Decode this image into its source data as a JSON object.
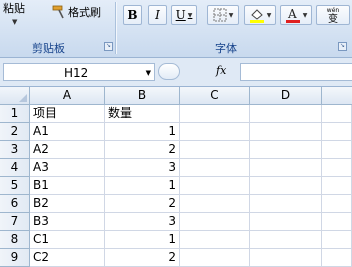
{
  "ribbon": {
    "paste_label": "粘贴",
    "format_painter_label": "格式刷",
    "clipboard_group_label": "剪贴板",
    "font_group_label": "字体",
    "bold_label": "B",
    "italic_label": "I",
    "underline_label": "U",
    "phonetic_top": "wén",
    "phonetic_char": "变"
  },
  "formula_bar": {
    "name_box_value": "H12",
    "fx_label": "fx",
    "formula_value": ""
  },
  "columns": [
    "A",
    "B",
    "C",
    "D"
  ],
  "rows": [
    {
      "num": "1",
      "a": "项目",
      "b": ""
    },
    {
      "num": "2",
      "a": "A1",
      "b": "1"
    },
    {
      "num": "3",
      "a": "A2",
      "b": "2"
    },
    {
      "num": "4",
      "a": "A3",
      "b": "3"
    },
    {
      "num": "5",
      "a": "B1",
      "b": "1"
    },
    {
      "num": "6",
      "a": "B2",
      "b": "2"
    },
    {
      "num": "7",
      "a": "B3",
      "b": "3"
    },
    {
      "num": "8",
      "a": "C1",
      "b": "1"
    },
    {
      "num": "9",
      "a": "C2",
      "b": "2"
    }
  ],
  "header_b1": "数量",
  "colors": {
    "fill_accent": "#ffff00",
    "font_color_accent": "#e02020"
  }
}
